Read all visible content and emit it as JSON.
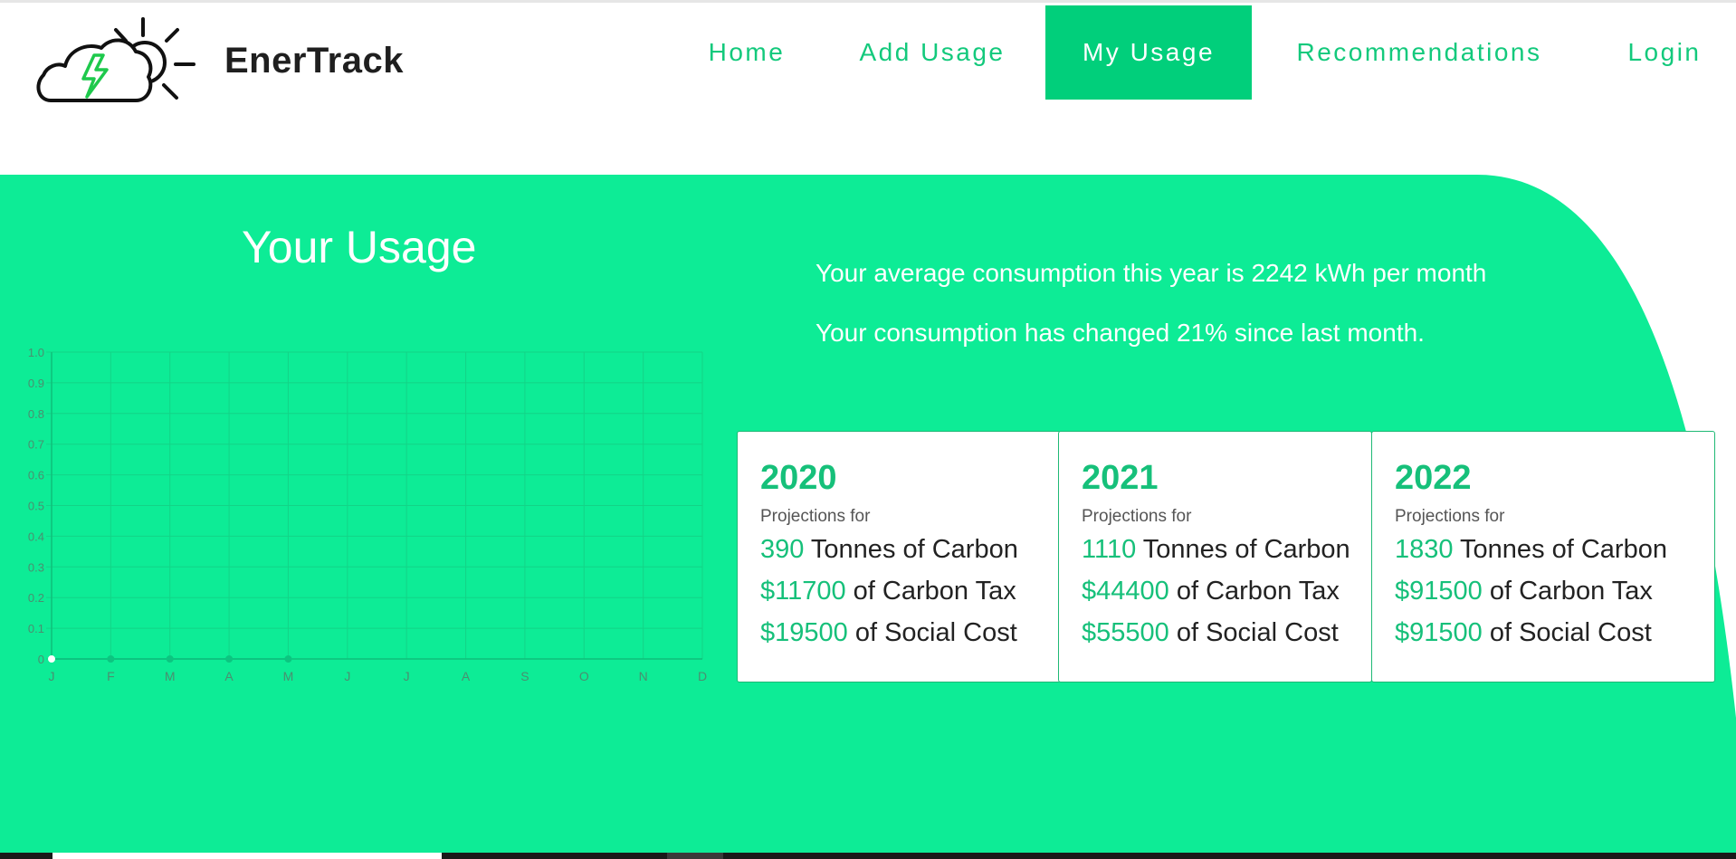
{
  "header": {
    "brand": "EnerTrack",
    "logo_icon": "cloud-sun-lightning-icon",
    "nav": [
      {
        "label": "Home"
      },
      {
        "label": "Add Usage"
      },
      {
        "label": "My Usage",
        "active": true
      },
      {
        "label": "Recommendations"
      },
      {
        "label": "Login"
      }
    ]
  },
  "main": {
    "title": "Your Usage",
    "stats": [
      "Your average consumption this year is 2242 kWh per month",
      "Your consumption has changed 21% since last month."
    ],
    "cards": [
      {
        "year": "2020",
        "subtitle": "Projections for",
        "carbon_num": "390",
        "carbon_text": " Tonnes of Carbon",
        "tax_num": "$11700",
        "tax_text": " of Carbon Tax",
        "social_num": "$19500",
        "social_text": " of Social Cost"
      },
      {
        "year": "2021",
        "subtitle": "Projections for",
        "carbon_num": "1110",
        "carbon_text": " Tonnes of Carbon",
        "tax_num": "$44400",
        "tax_text": " of Carbon Tax",
        "social_num": "$55500",
        "social_text": " of Social Cost"
      },
      {
        "year": "2022",
        "subtitle": "Projections for",
        "carbon_num": "1830",
        "carbon_text": " Tonnes of Carbon",
        "tax_num": "$91500",
        "tax_text": " of Carbon Tax",
        "social_num": "$91500",
        "social_text": " of Social Cost"
      }
    ]
  },
  "colors": {
    "accent": "#0dec96",
    "nav_active": "#01cf7b",
    "nav_text": "#13c97c",
    "value_green": "#16c07a"
  },
  "chart_data": {
    "type": "line",
    "categories": [
      "J",
      "F",
      "M",
      "A",
      "M",
      "J",
      "J",
      "A",
      "S",
      "O",
      "N",
      "D"
    ],
    "yticks": [
      "1.0",
      "0.9",
      "0.8",
      "0.7",
      "0.6",
      "0.5",
      "0.4",
      "0.3",
      "0.2",
      "0.1",
      "0"
    ],
    "values": [
      0,
      0,
      0,
      0,
      0
    ],
    "ylim": [
      0,
      1.0
    ],
    "grid": true
  }
}
